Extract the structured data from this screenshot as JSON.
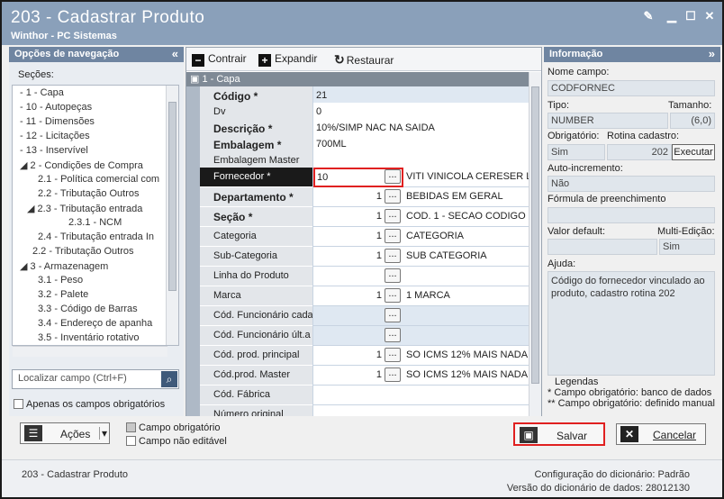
{
  "window": {
    "title": "203 - Cadastrar  Produto",
    "subtitle": "Winthor - PC Sistemas"
  },
  "left": {
    "header": "Opções de navegação",
    "secoes_label": "Seções:",
    "tree": [
      "- 1 - Capa",
      "- 10 - Autopeças",
      "- 11 - Dimensões",
      "- 12 - Licitações",
      "- 13 - Inservível",
      "2 - Condições de Compra",
      "2.1 - Política comercial com",
      "2.2 - Tributação Outros",
      "2.3 - Tributação entrada",
      "2.3.1 - NCM",
      "2.4 - Tributação entrada In",
      "2.2 - Tributação Outros",
      "3 - Armazenagem",
      "3.1 - Peso",
      "3.2 - Palete",
      "3.3 - Código de Barras",
      "3.4 - Endereço de apanha",
      "3.5 - Inventário rotativo"
    ],
    "search_placeholder": "Localizar campo (Ctrl+F)",
    "apenas_label": "Apenas os campos obrigatórios"
  },
  "toolbar": {
    "contrair": "Contrair",
    "expandir": "Expandir",
    "restaurar": "Restaurar"
  },
  "capa_header": "1 - Capa",
  "fields": [
    {
      "label": "Código *",
      "value": "21"
    },
    {
      "label": "Dv",
      "value": "0"
    },
    {
      "label": "Descrição *",
      "value": "10%/SIMP NAC NA SAIDA"
    },
    {
      "label": "Embalagem *",
      "value": "700ML"
    },
    {
      "label": "Embalagem Master",
      "value": ""
    },
    {
      "label": "Fornecedor *",
      "num": "10",
      "desc": "VITI VINICOLA CERESER LTI"
    },
    {
      "label": "Departamento *",
      "num": "1",
      "desc": "BEBIDAS EM GERAL"
    },
    {
      "label": "Seção *",
      "num": "1",
      "desc": "COD. 1 - SECAO CODIGO 1"
    },
    {
      "label": "Categoria",
      "num": "1",
      "desc": "CATEGORIA"
    },
    {
      "label": "Sub-Categoria",
      "num": "1",
      "desc": "SUB CATEGORIA"
    },
    {
      "label": "Linha do Produto",
      "num": "",
      "desc": ""
    },
    {
      "label": "Marca",
      "num": "1",
      "desc": "1 MARCA"
    },
    {
      "label": "Cód. Funcionário cada",
      "num": "",
      "desc": ""
    },
    {
      "label": "Cód. Funcionário últ.a",
      "num": "",
      "desc": ""
    },
    {
      "label": "Cód. prod. principal",
      "num": "1",
      "desc": "SO ICMS 12% MAIS NADA"
    },
    {
      "label": "Cód.prod. Master",
      "num": "1",
      "desc": "SO ICMS 12% MAIS NADA"
    },
    {
      "label": "Cód. Fábrica",
      "value": ""
    },
    {
      "label": "Número original",
      "value": ""
    }
  ],
  "dots": "...",
  "right": {
    "header": "Informação",
    "nome_campo_label": "Nome campo:",
    "nome_campo": "CODFORNEC",
    "tipo_label": "Tipo:",
    "tamanho_label": "Tamanho:",
    "tipo": "NUMBER",
    "tamanho": "(6,0)",
    "obrigatorio_label": "Obrigatório:",
    "rotina_label": "Rotina cadastro:",
    "obrigatorio": "Sim",
    "rotina": "202",
    "executar": "Executar",
    "autoinc_label": "Auto-incremento:",
    "autoinc": "Não",
    "formula_label": "Fórmula de preenchimento",
    "default_label": "Valor default:",
    "multi_label": "Multi-Edição:",
    "multi": "Sim",
    "ajuda_label": "Ajuda:",
    "ajuda": "Código do fornecedor vinculado ao produto, cadastro rotina 202",
    "legendas_title": "Legendas",
    "legenda1": "* Campo obrigatório: banco de dados",
    "legenda2": "** Campo obrigatório: definido manual"
  },
  "bottom": {
    "acoes": "Ações",
    "campo_obrigatorio": "Campo obrigatório",
    "campo_nao_editavel": "Campo não editável",
    "salvar": "Salvar",
    "cancelar": "Cancelar"
  },
  "status": {
    "left": "203 - Cadastrar  Produto",
    "config_label": "Configuração do dicionário:",
    "config_value": "Padrão",
    "versao_label": "Versão do dicionário de dados:",
    "versao_value": "28012130"
  }
}
